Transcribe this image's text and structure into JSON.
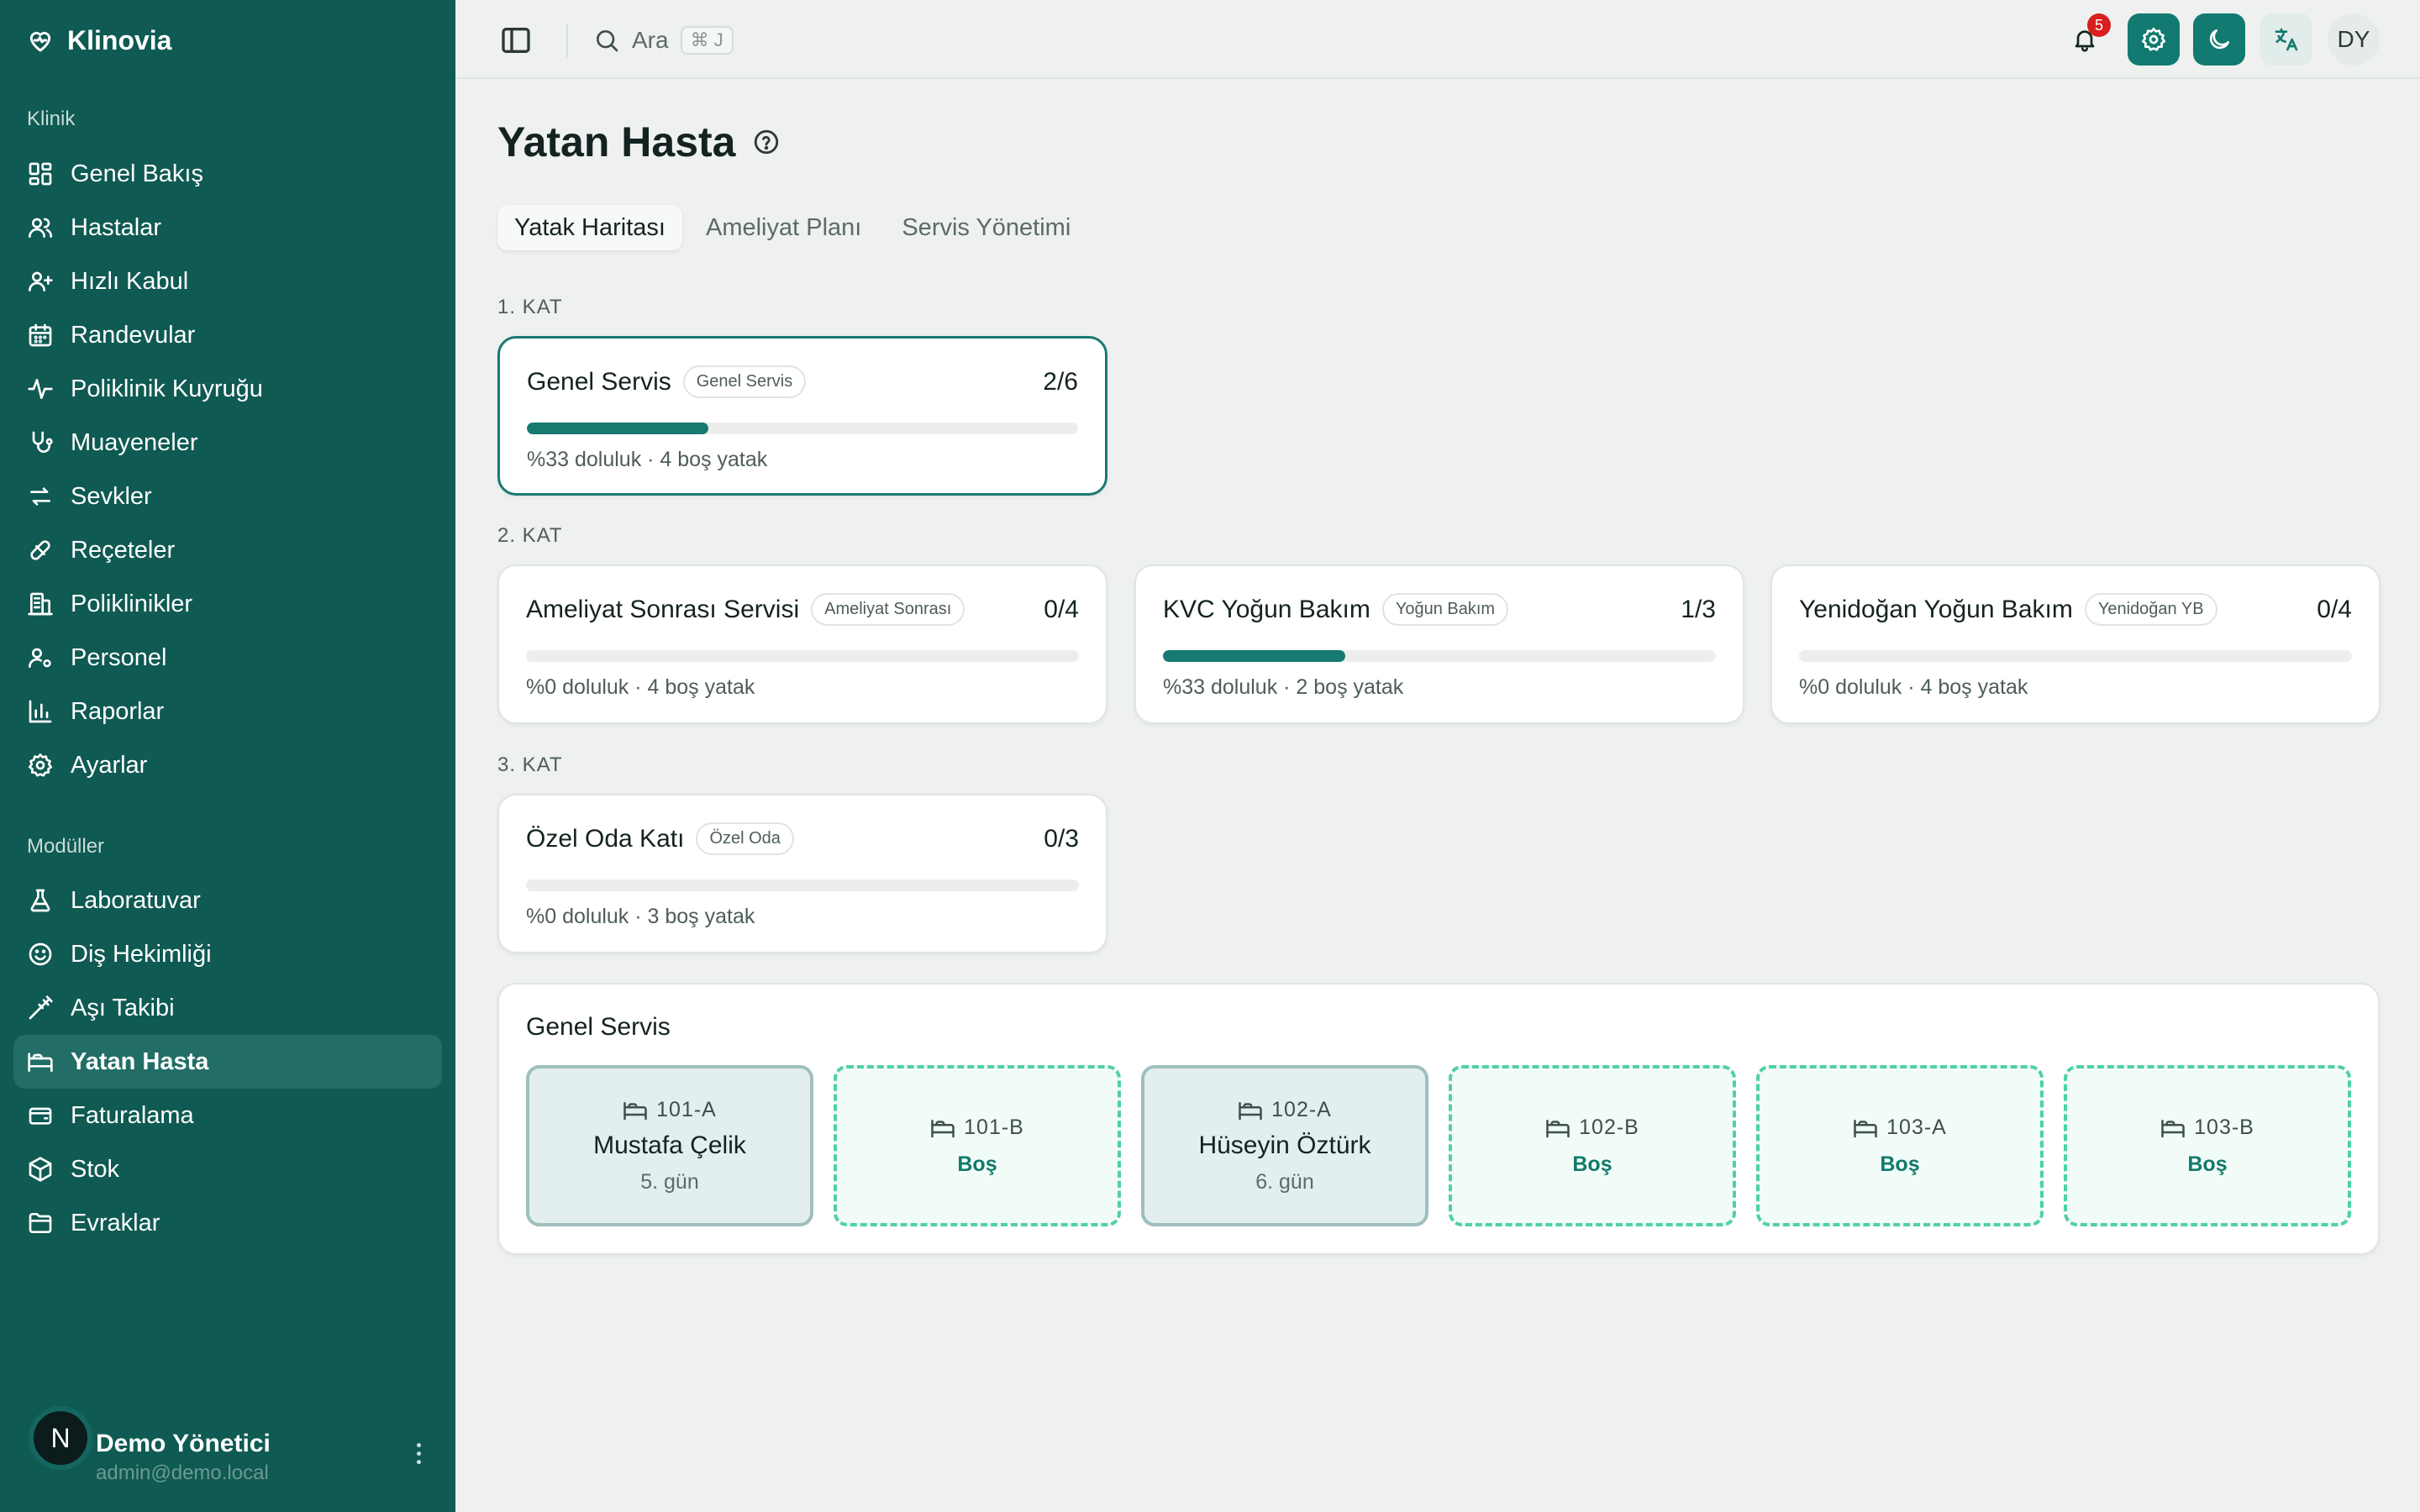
{
  "brand": {
    "name": "Klinovia"
  },
  "sidebar": {
    "section_clinic": "Klinik",
    "clinic_items": [
      {
        "label": "Genel Bakış",
        "icon": "grid-icon"
      },
      {
        "label": "Hastalar",
        "icon": "users-icon"
      },
      {
        "label": "Hızlı Kabul",
        "icon": "user-plus-icon"
      },
      {
        "label": "Randevular",
        "icon": "calendar-icon"
      },
      {
        "label": "Poliklinik Kuyruğu",
        "icon": "activity-icon"
      },
      {
        "label": "Muayeneler",
        "icon": "stethoscope-icon"
      },
      {
        "label": "Sevkler",
        "icon": "arrows-swap-icon"
      },
      {
        "label": "Reçeteler",
        "icon": "pill-icon"
      },
      {
        "label": "Poliklinikler",
        "icon": "building-icon"
      },
      {
        "label": "Personel",
        "icon": "user-cog-icon"
      },
      {
        "label": "Raporlar",
        "icon": "bar-chart-icon"
      },
      {
        "label": "Ayarlar",
        "icon": "gear-icon"
      }
    ],
    "section_modules": "Modüller",
    "module_items": [
      {
        "label": "Laboratuvar",
        "icon": "flask-icon"
      },
      {
        "label": "Diş Hekimliği",
        "icon": "smile-icon"
      },
      {
        "label": "Aşı Takibi",
        "icon": "syringe-icon"
      },
      {
        "label": "Yatan Hasta",
        "icon": "bed-icon",
        "active": true
      },
      {
        "label": "Faturalama",
        "icon": "wallet-icon"
      },
      {
        "label": "Stok",
        "icon": "box-icon"
      },
      {
        "label": "Evraklar",
        "icon": "folder-icon"
      }
    ],
    "user": {
      "initial": "N",
      "name": "Demo Yönetici",
      "email": "admin@demo.local"
    }
  },
  "header": {
    "search_label": "Ara",
    "search_shortcut": "⌘ J",
    "notification_count": "5",
    "user_initials": "DY"
  },
  "page": {
    "title": "Yatan Hasta",
    "tabs": [
      {
        "label": "Yatak Haritası",
        "active": true
      },
      {
        "label": "Ameliyat Planı"
      },
      {
        "label": "Servis Yönetimi"
      }
    ]
  },
  "floors": [
    {
      "label": "1. KAT",
      "wards": [
        {
          "name": "Genel Servis",
          "tag": "Genel Servis",
          "count": "2/6",
          "occupancy": 0.33,
          "stats": "%33 doluluk · 4 boş yatak",
          "selected": true
        }
      ]
    },
    {
      "label": "2. KAT",
      "wards": [
        {
          "name": "Ameliyat Sonrası Servisi",
          "tag": "Ameliyat Sonrası",
          "count": "0/4",
          "occupancy": 0,
          "stats": "%0 doluluk · 4 boş yatak"
        },
        {
          "name": "KVC Yoğun Bakım",
          "tag": "Yoğun Bakım",
          "count": "1/3",
          "occupancy": 0.33,
          "stats": "%33 doluluk · 2 boş yatak"
        },
        {
          "name": "Yenidoğan Yoğun Bakım",
          "tag": "Yenidoğan YB",
          "count": "0/4",
          "occupancy": 0,
          "stats": "%0 doluluk · 4 boş yatak"
        }
      ]
    },
    {
      "label": "3. KAT",
      "wards": [
        {
          "name": "Özel Oda Katı",
          "tag": "Özel Oda",
          "count": "0/3",
          "occupancy": 0,
          "stats": "%0 doluluk · 3 boş yatak"
        }
      ]
    }
  ],
  "bed_panel": {
    "title": "Genel Servis",
    "beds": [
      {
        "code": "101-A",
        "patient": "Mustafa Çelik",
        "day": "5. gün",
        "occupied": true
      },
      {
        "code": "101-B",
        "status": "Boş",
        "occupied": false
      },
      {
        "code": "102-A",
        "patient": "Hüseyin Öztürk",
        "day": "6. gün",
        "occupied": true
      },
      {
        "code": "102-B",
        "status": "Boş",
        "occupied": false
      },
      {
        "code": "103-A",
        "status": "Boş",
        "occupied": false
      },
      {
        "code": "103-B",
        "status": "Boş",
        "occupied": false
      }
    ]
  },
  "colors": {
    "sidebar": "#0f5a52",
    "accent": "#127a70",
    "free_bed_border": "#4fd0a8",
    "badge": "#d91e1e"
  }
}
